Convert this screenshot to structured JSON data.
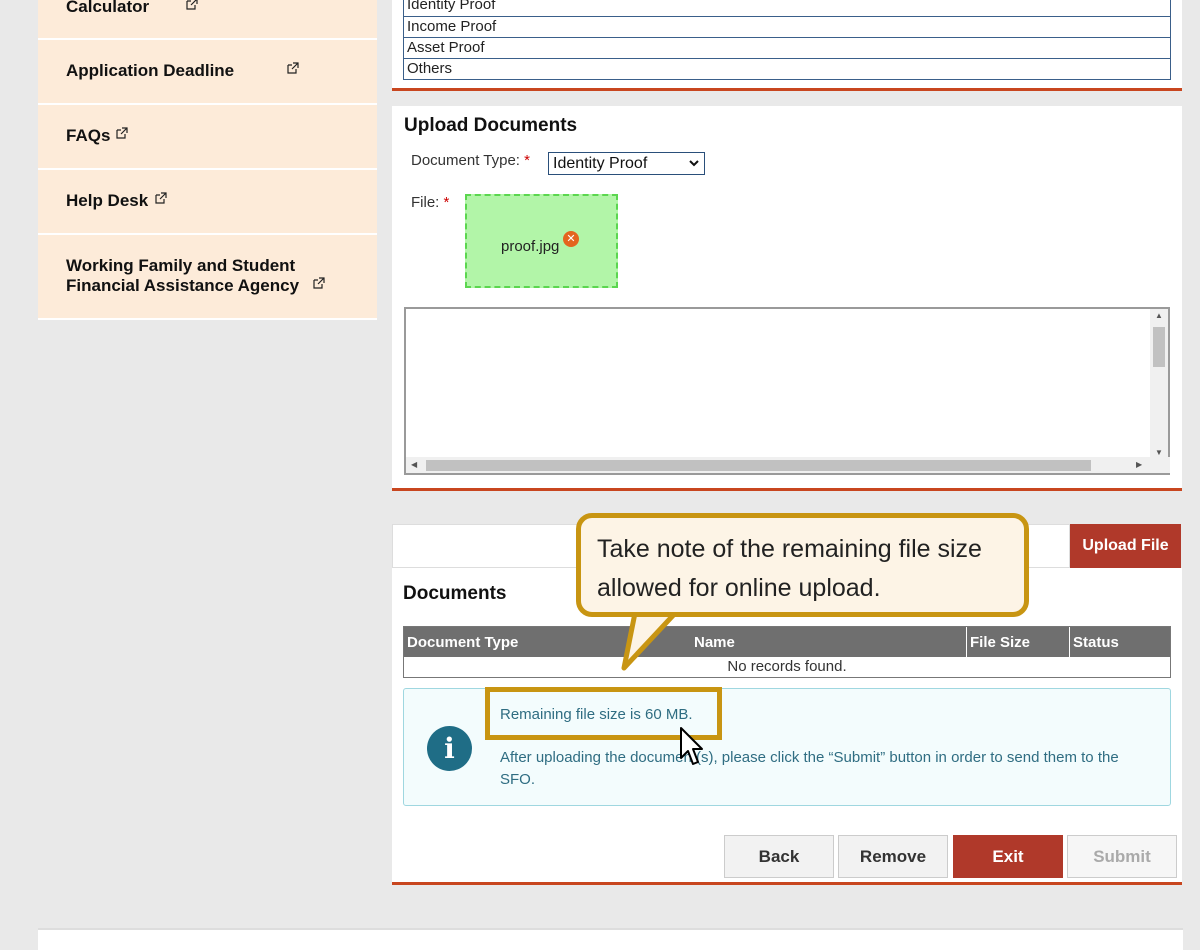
{
  "sidebar": {
    "items": [
      {
        "label": "Calculator"
      },
      {
        "label": "Application Deadline"
      },
      {
        "label": "FAQs"
      },
      {
        "label": "Help Desk"
      },
      {
        "label": "Working Family and Student",
        "label2": "Financial Assistance Agency"
      }
    ]
  },
  "doc_types_list": [
    "Identity Proof",
    "Income Proof",
    "Asset Proof",
    "Others"
  ],
  "upload": {
    "title": "Upload Documents",
    "doc_type_label": "Document Type:",
    "required_mark": "*",
    "doc_type_value": "Identity Proof",
    "file_label": "File:",
    "file_name": "proof.jpg"
  },
  "upload_button": "Upload File",
  "documents": {
    "title": "Documents",
    "columns": [
      "Document Type",
      "Name",
      "File Size",
      "Status"
    ],
    "empty_text": "No records found."
  },
  "info": {
    "remaining": "Remaining file size is 60 MB.",
    "note_line1": "After uploading the document(s), please click the “Submit” button in order to send them to the",
    "note_line2": "SFO."
  },
  "buttons": {
    "back": "Back",
    "remove": "Remove",
    "exit": "Exit",
    "submit": "Submit"
  },
  "callout": {
    "line1": "Take note of the remaining file size",
    "line2": "allowed for online upload."
  },
  "colors": {
    "accent": "#b0392a",
    "sidebar_bg": "#fdebd9",
    "callout_border": "#c89512"
  }
}
